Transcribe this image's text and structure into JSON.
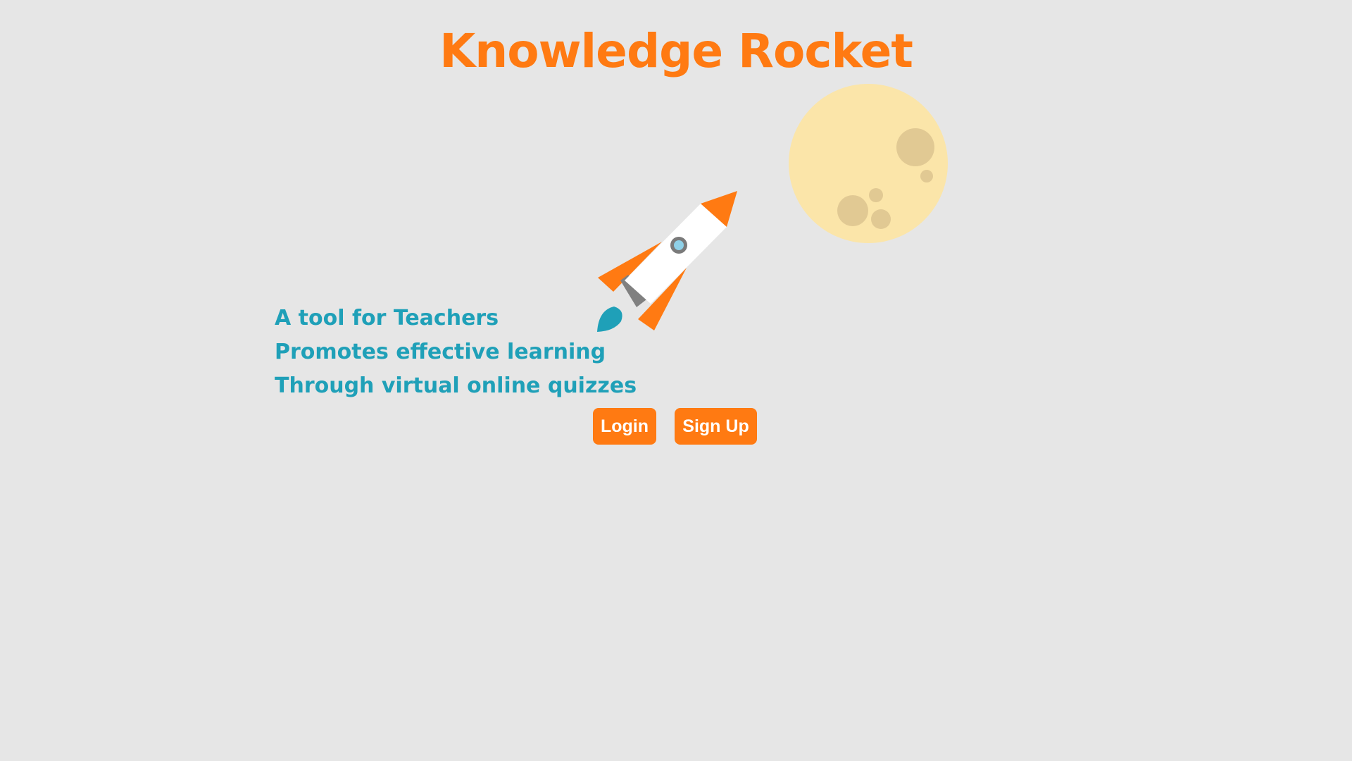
{
  "header": {
    "title": "Knowledge Rocket"
  },
  "taglines": [
    "A tool for Teachers",
    "Promotes effective learning",
    "Through virtual online quizzes"
  ],
  "buttons": {
    "login_label": "Login",
    "signup_label": "Sign Up"
  },
  "illustration": {
    "rocket_icon": "rocket-icon",
    "moon_icon": "moon-icon"
  },
  "colors": {
    "background": "#e6e6e6",
    "accent_orange": "#ff7a12",
    "teal": "#1fa0b8",
    "moon": "#fbe5a9",
    "crater": "#e1c993"
  }
}
